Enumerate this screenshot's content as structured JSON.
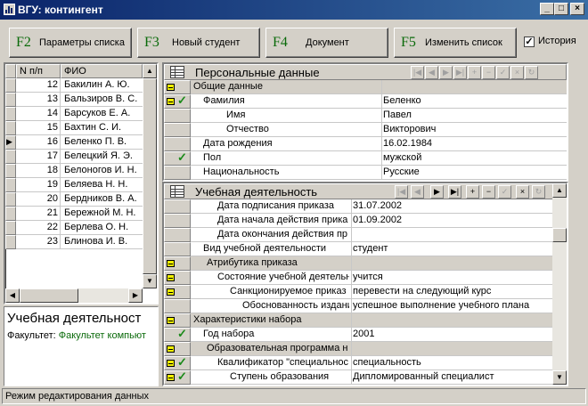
{
  "window": {
    "title": "ВГУ: контингент"
  },
  "toolbar": {
    "buttons": [
      {
        "key": "F2",
        "label": "Параметры списка"
      },
      {
        "key": "F3",
        "label": "Новый студент"
      },
      {
        "key": "F4",
        "label": "Документ"
      },
      {
        "key": "F5",
        "label": "Изменить список"
      }
    ],
    "history_label": "История",
    "history_checked": true
  },
  "student_list": {
    "columns": [
      "N п/п",
      "ФИО"
    ],
    "rows": [
      {
        "n": "12",
        "name": "Бакилин А. Ю."
      },
      {
        "n": "13",
        "name": "Бальзиров В. С."
      },
      {
        "n": "14",
        "name": "Барсуков Е. А."
      },
      {
        "n": "15",
        "name": "Бахтин С. И."
      },
      {
        "n": "16",
        "name": "Беленко П. В.",
        "current": true
      },
      {
        "n": "17",
        "name": "Белецкий Я. Э."
      },
      {
        "n": "18",
        "name": "Белоногов И. Н."
      },
      {
        "n": "19",
        "name": "Беляева Н. Н."
      },
      {
        "n": "20",
        "name": "Бердников В. А."
      },
      {
        "n": "21",
        "name": "Бережной М. Н."
      },
      {
        "n": "22",
        "name": "Берлева О. Н."
      },
      {
        "n": "23",
        "name": "Блинова И. В."
      }
    ]
  },
  "summary": {
    "title": "Учебная деятельност",
    "faculty_label": "Факультет:",
    "faculty_value": "Факультет компьют"
  },
  "personal": {
    "title": "Персональные данные",
    "rows": [
      {
        "label": "Общие данные",
        "value": "",
        "group": true,
        "mark": true
      },
      {
        "label": "Фамилия",
        "value": "Беленко",
        "mark": true,
        "check": true
      },
      {
        "label": "Имя",
        "value": "Павел"
      },
      {
        "label": "Отчество",
        "value": "Викторович"
      },
      {
        "label": "Дата рождения",
        "value": "16.02.1984"
      },
      {
        "label": "Пол",
        "value": "мужской",
        "check": true
      },
      {
        "label": "Национальность",
        "value": "Русские"
      }
    ]
  },
  "study": {
    "title": "Учебная деятельность",
    "rows": [
      {
        "label": "Дата подписания приказа",
        "value": "31.07.2002"
      },
      {
        "label": "Дата начала действия прика",
        "value": "01.09.2002"
      },
      {
        "label": "Дата окончания действия пр",
        "value": ""
      },
      {
        "label": "Вид учебной деятельности",
        "value": "студент"
      },
      {
        "label": "Атрибутика приказа",
        "value": "",
        "group": true,
        "mark": true
      },
      {
        "label": "Состояние учебной деятельн",
        "value": "учится",
        "mark": true
      },
      {
        "label": "Санкционируемое приказ",
        "value": "перевести на следующий курс",
        "mark": true
      },
      {
        "label": "Обоснованность издани",
        "value": "успешное выполнение учебного плана"
      },
      {
        "label": "Характеристики набора",
        "value": "",
        "group": true,
        "mark": true
      },
      {
        "label": "Год набора",
        "value": "2001",
        "check": true
      },
      {
        "label": "Образовательная программа н",
        "value": "",
        "group": true,
        "mark": true
      },
      {
        "label": "Квалификатор \"специальнос",
        "value": "специальность",
        "mark": true,
        "check": true
      },
      {
        "label": "Ступень образования",
        "value": "Дипломированный специалист",
        "mark": true,
        "check": true
      }
    ]
  },
  "status_bar": {
    "text": "Режим редактирования данных"
  },
  "colors": {
    "title_bar": "#0a246a",
    "accent_green": "#0a6a0a",
    "group_bg": "#d4d0c8",
    "mark_yellow": "#f0f000"
  }
}
